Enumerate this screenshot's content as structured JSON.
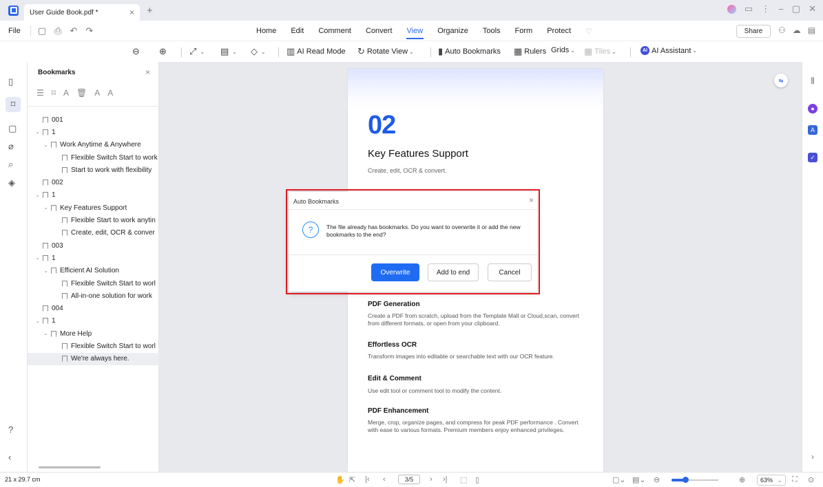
{
  "window": {
    "tab_title": "User Guide Book.pdf *"
  },
  "menubar": {
    "file": "File",
    "items": [
      "Home",
      "Edit",
      "Comment",
      "Convert",
      "View",
      "Organize",
      "Tools",
      "Form",
      "Protect"
    ],
    "active": "View",
    "share": "Share"
  },
  "toolbar": {
    "ai_read_mode": "AI Read Mode",
    "rotate_view": "Rotate View",
    "auto_bookmarks": "Auto Bookmarks",
    "rulers": "Rulers",
    "grids": "Grids",
    "tiles": "Tiles",
    "ai_assistant": "AI Assistant"
  },
  "bookmarks": {
    "title": "Bookmarks",
    "items": [
      {
        "label": "001",
        "level": 0,
        "chevron": false
      },
      {
        "label": "1",
        "level": 0,
        "chevron": true
      },
      {
        "label": "Work Anytime & Anywhere",
        "level": 1,
        "chevron": true
      },
      {
        "label": "Flexible Switch Start to work",
        "level": 2,
        "chevron": false
      },
      {
        "label": "Start to work with flexibility",
        "level": 2,
        "chevron": false
      },
      {
        "label": "002",
        "level": 0,
        "chevron": false
      },
      {
        "label": "1",
        "level": 0,
        "chevron": true
      },
      {
        "label": "Key Features Support",
        "level": 1,
        "chevron": true
      },
      {
        "label": "Flexible Start to work anytin",
        "level": 2,
        "chevron": false
      },
      {
        "label": "Create, edit, OCR & conver",
        "level": 2,
        "chevron": false
      },
      {
        "label": "003",
        "level": 0,
        "chevron": false
      },
      {
        "label": "1",
        "level": 0,
        "chevron": true
      },
      {
        "label": "Efficient AI Solution",
        "level": 1,
        "chevron": true
      },
      {
        "label": "Flexible Switch Start to worl",
        "level": 2,
        "chevron": false
      },
      {
        "label": "All-in-one solution for work",
        "level": 2,
        "chevron": false
      },
      {
        "label": "004",
        "level": 0,
        "chevron": false
      },
      {
        "label": "1",
        "level": 0,
        "chevron": true
      },
      {
        "label": "More Help",
        "level": 1,
        "chevron": true
      },
      {
        "label": "Flexible Switch Start to worl",
        "level": 2,
        "chevron": false
      },
      {
        "label": "We're always here.",
        "level": 2,
        "chevron": false,
        "selected": true
      }
    ]
  },
  "page": {
    "number": "02",
    "heading": "Key Features Support",
    "subheading": "Create, edit, OCR & convert.",
    "sections": [
      {
        "title": "PDF Generation",
        "body": "Create a PDF from scratch, upload from the Template Mall or Cloud,scan, convert from different formats, or open from your clipboard."
      },
      {
        "title": "Effortless OCR",
        "body": "Transform images into editable or searchable text with our OCR feature."
      },
      {
        "title": "Edit & Comment",
        "body": "Use edit tool or comment tool to modify the content."
      },
      {
        "title": "PDF Enhancement",
        "body": "Merge, crop, organize pages, and compress for peak PDF performance . Convert with ease to various formats. Premium members enjoy enhanced privileges."
      }
    ]
  },
  "dialog": {
    "title": "Auto Bookmarks",
    "message": "The file already has bookmarks. Do you want to overwrite it or add the new bookmarks to the end?",
    "overwrite": "Overwrite",
    "add_to_end": "Add to end",
    "cancel": "Cancel"
  },
  "statusbar": {
    "page_size": "21 x 29.7 cm",
    "page_indicator": "3/5",
    "zoom": "63%",
    "zoom_level_fraction": 0.3
  },
  "colors": {
    "accent": "#2c68e6",
    "highlight_border": "#e11b22",
    "page_number": "#1d5bea"
  }
}
